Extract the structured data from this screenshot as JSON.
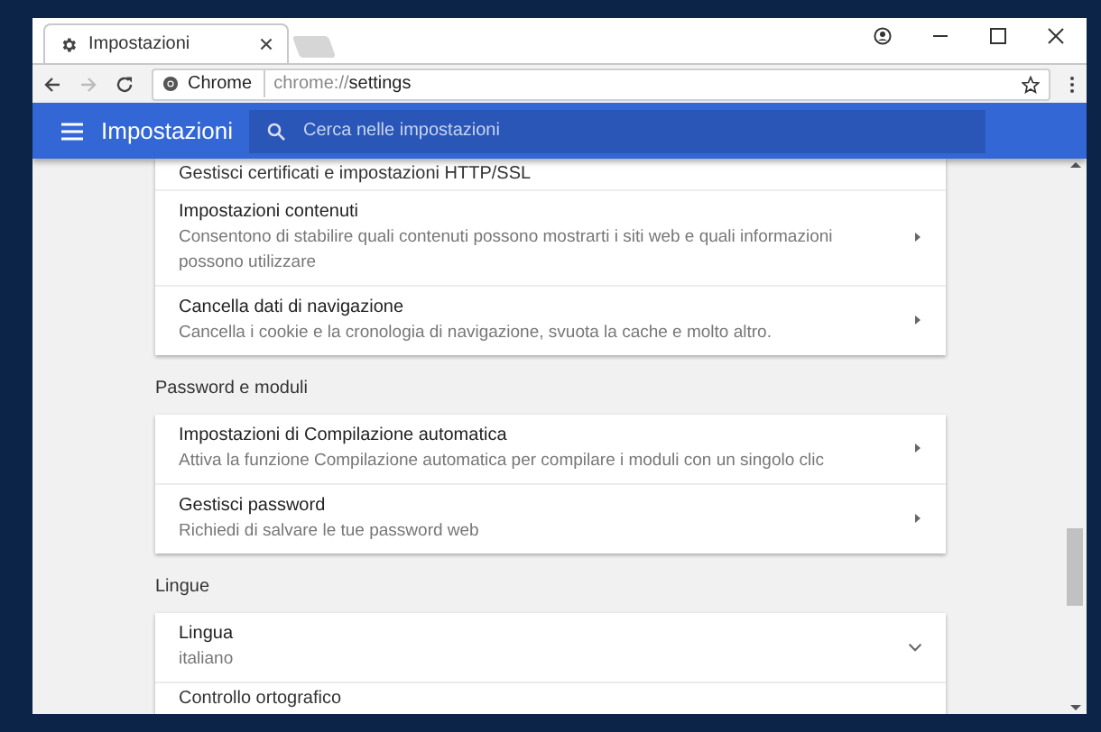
{
  "tab": {
    "title": "Impostazioni",
    "selected": true
  },
  "omnibox": {
    "site_label": "Chrome",
    "url_prefix": "chrome://",
    "url_path": "settings"
  },
  "header": {
    "title": "Impostazioni",
    "search": {
      "placeholder": "Cerca nelle impostazioni"
    }
  },
  "sections": [
    {
      "items": [
        {
          "kind": "partial",
          "title": "Gestisci certificati e impostazioni HTTP/SSL"
        },
        {
          "kind": "link",
          "title": "Impostazioni contenuti",
          "description": "Consentono di stabilire quali contenuti possono mostrarti i siti web e quali informazioni possono utilizzare"
        },
        {
          "kind": "link",
          "title": "Cancella dati di navigazione",
          "description": "Cancella i cookie e la cronologia di navigazione, svuota la cache e molto altro."
        }
      ]
    },
    {
      "heading": "Password e moduli",
      "items": [
        {
          "kind": "link",
          "title": "Impostazioni di Compilazione automatica",
          "description": "Attiva la funzione Compilazione automatica per compilare i moduli con un singolo clic"
        },
        {
          "kind": "link",
          "title": "Gestisci password",
          "description": "Richiedi di salvare le tue password web"
        }
      ]
    },
    {
      "heading": "Lingue",
      "items": [
        {
          "kind": "expand",
          "title": "Lingua",
          "description": "italiano",
          "expanded": false
        },
        {
          "kind": "partial",
          "title": "Controllo ortografico"
        }
      ]
    }
  ]
}
